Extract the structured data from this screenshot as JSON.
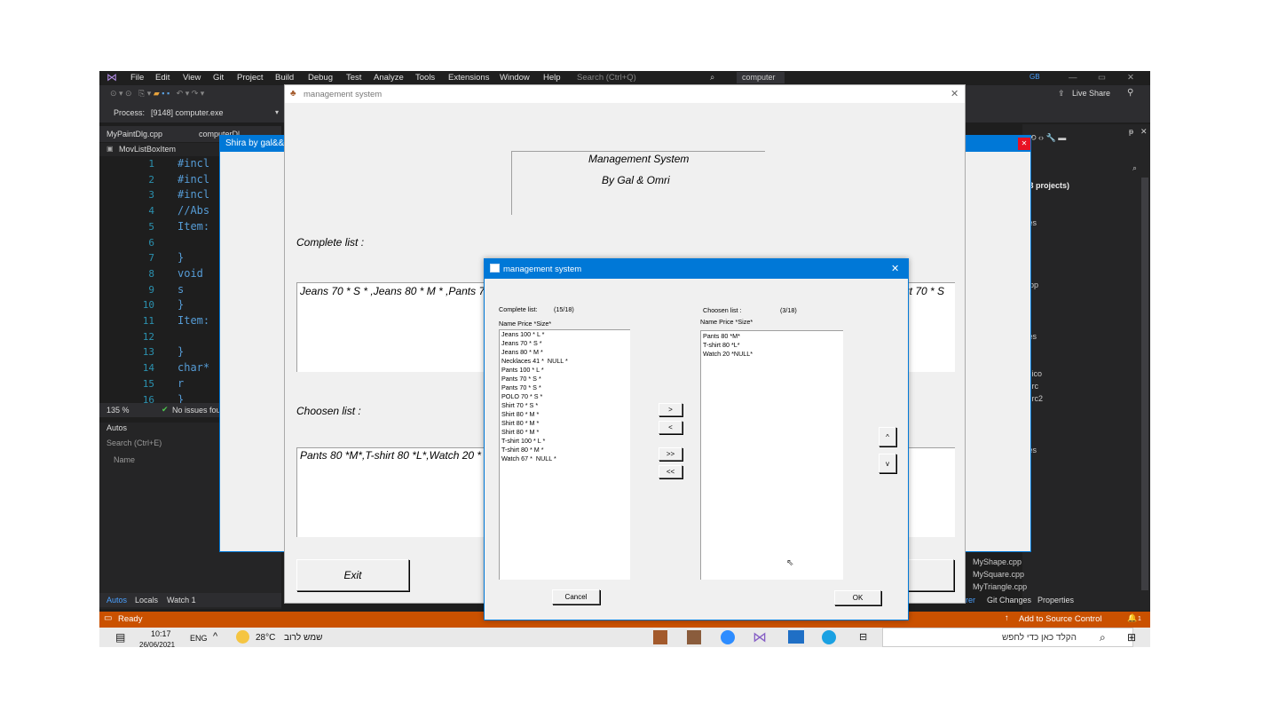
{
  "vs": {
    "menu": [
      "File",
      "Edit",
      "View",
      "Git",
      "Project",
      "Build",
      "Debug",
      "Test",
      "Analyze",
      "Tools",
      "Extensions",
      "Window",
      "Help"
    ],
    "search_placeholder": "Search (Ctrl+Q)",
    "solution_name": "computer",
    "user_initials": "GB",
    "live_share": "Live Share",
    "process_label": "Process:",
    "process_value": "[9148] computer.exe",
    "file_tabs": [
      "MyPaintDlg.cpp",
      "computerDl"
    ],
    "member_dropdown": "MovListBoxItem",
    "line_numbers": [
      "1",
      "2",
      "3",
      "4",
      "5",
      "6",
      "7",
      "8",
      "9",
      "10",
      "11",
      "12",
      "13",
      "14",
      "15",
      "16"
    ],
    "code_lines": [
      "#incl",
      "#incl",
      "#incl",
      "//Abs",
      "Item:",
      "",
      "}",
      "void",
      "s",
      "}",
      "Item:",
      "",
      "}",
      "char*",
      "r",
      "}"
    ],
    "zoom": "135 %",
    "issues": "No issues fou",
    "autos_title": "Autos",
    "autos_search": "Search (Ctrl+E)",
    "autos_col_name": "Name",
    "bottom_tabs": [
      "Autos",
      "Locals",
      "Watch 1"
    ],
    "right_panel": [
      "7 3 projects)",
      "cies",
      "pp",
      "cies",
      ".ico",
      ".rc",
      ".rc2",
      "cies"
    ],
    "right_files": [
      "MyShape.cpp",
      "MySquare.cpp",
      "MyTriangle.cpp"
    ],
    "right_tabs": [
      "rer",
      "Git Changes",
      "Properties"
    ],
    "status_ready": "Ready",
    "status_source_control": "Add to Source Control",
    "notif_count": "1"
  },
  "taskbar": {
    "time": "10:17",
    "date": "26/06/2021",
    "lang": "ENG",
    "temp": "28°C",
    "weather": "שמש לרוב",
    "search_text": "הקלד כאן כדי לחפש"
  },
  "blue_window": {
    "title": "Shira by gal&&o"
  },
  "main_window": {
    "title": "management system",
    "heading_line1": "Management System",
    "heading_line2": "By Gal & Omri",
    "complete_label": "Complete list :",
    "complete_text_left": "Jeans 70 * S * ,Jeans 80 * M * ,Pants 7",
    "complete_text_right": "irt 70 * S",
    "choosen_label": "Choosen list :",
    "choosen_text": "Pants 80 *M*,T-shirt 80 *L*,Watch 20 *",
    "exit_button": "Exit"
  },
  "dialog": {
    "title": "management system",
    "complete_label": "Complete list:",
    "complete_count": "(15/18)",
    "choosen_label": "Choosen list :",
    "choosen_count": "(3/18)",
    "column_header_left": "Name Price *Size*",
    "column_header_right": "Name Price *Size*",
    "complete_items": [
      "Jeans 100 * L *",
      "Jeans 70 * S *",
      "Jeans 80 * M *",
      "Necklaces 41 *  NULL *",
      "Pants 100 * L *",
      "Pants 70 * S *",
      "Pants 70 * S *",
      "POLO 70 * S *",
      "Shirt 70 * S *",
      "Shirt 80 * M *",
      "Shirt 80 * M *",
      "Shirt 80 * M *",
      "T-shirt 100 * L *",
      "T-shirt 80 * M *",
      "Watch 67 *  NULL *"
    ],
    "choosen_items": [
      "Pants 80 *M*",
      "T-shirt 80 *L*",
      "Watch 20 *NULL*"
    ],
    "btn_move_right": ">",
    "btn_move_left": "<",
    "btn_move_all_right": ">>",
    "btn_move_all_left": "<<",
    "btn_up": "^",
    "btn_down": "v",
    "btn_cancel": "Cancel",
    "btn_ok": "OK"
  }
}
